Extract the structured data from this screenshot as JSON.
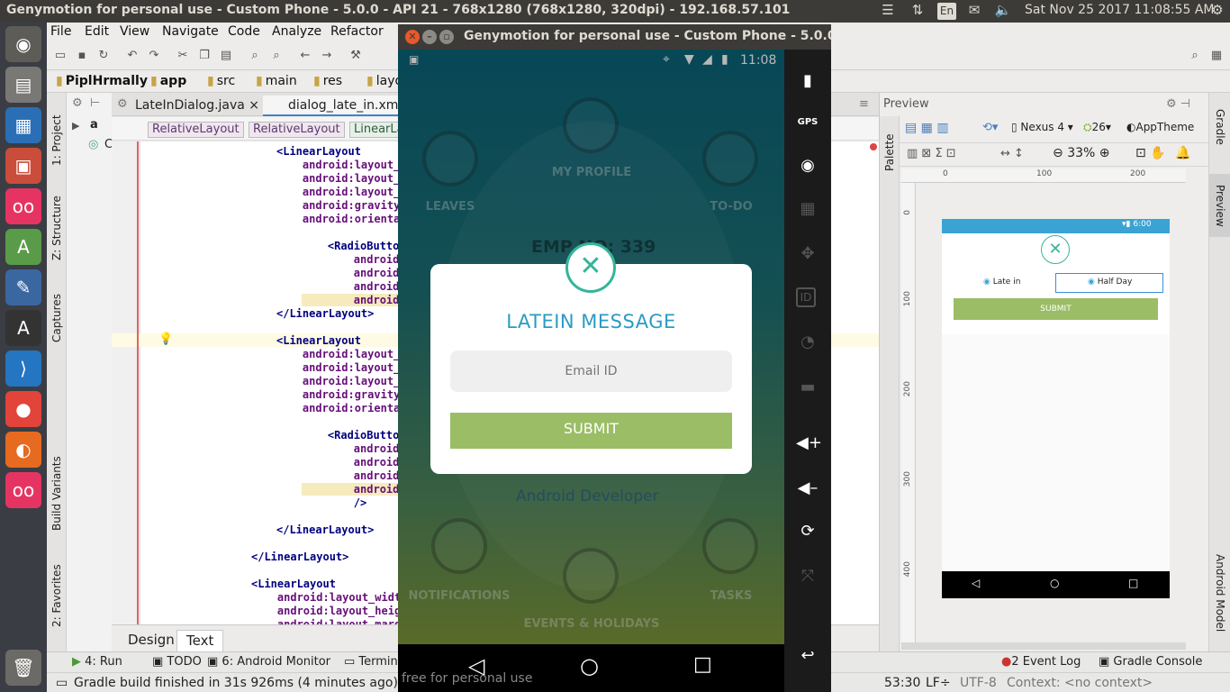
{
  "system_bar": {
    "window_title": "Genymotion for personal use - Custom Phone - 5.0.0 - API 21 - 768x1280 (768x1280, 320dpi) - 192.168.57.101",
    "keyboard_layout": "En",
    "volume": "",
    "datetime": "Sat Nov 25 2017 11:08:55 AM"
  },
  "ide": {
    "menu": [
      "File",
      "Edit",
      "View",
      "Navigate",
      "Code",
      "Analyze",
      "Refactor"
    ],
    "breadcrumbs": [
      "PiplHrmally",
      "app",
      "src",
      "main",
      "res",
      "layo"
    ],
    "editor_tabs": [
      "LateInDialog.java",
      "dialog_late_in.xml"
    ],
    "layout_crumbs": [
      "RelativeLayout",
      "RelativeLayout",
      "LinearLa"
    ],
    "project_node_a": "a",
    "project_node_c": "C",
    "left_tool_tabs": [
      "1: Project",
      "Z: Structure",
      "Captures",
      "Build Variants",
      "2: Favorites"
    ],
    "code_lines": [
      "<LinearLayout",
      "    android:layout_w",
      "    android:layout_",
      "    android:layout_w",
      "    android:gravity:",
      "    android:orientat",
      "",
      "    <RadioButton",
      "        android:layo",
      "        android:layo",
      "        android:chec",
      "        android:text",
      "</LinearLayout>",
      "",
      "<LinearLayout",
      "    android:layout_w",
      "    android:layout_",
      "    android:layout_w",
      "    android:gravity:",
      "    android:orientat",
      "",
      "    <RadioButton",
      "        android:layo",
      "        android:layo",
      "        android:chec",
      "        android:text",
      "        />",
      "",
      "</LinearLayout>",
      "",
      "</LinearLayout>",
      "",
      "<LinearLayout",
      "    android:layout_widt",
      "    android:layout_heig",
      "    android:layout_marg"
    ],
    "design_tabs": [
      "Design",
      "Text"
    ],
    "preview": {
      "label": "Preview",
      "device": "Nexus 4",
      "api": "26",
      "theme": "AppTheme",
      "zoom": "33%",
      "ruler_x": [
        "0",
        "100",
        "200"
      ],
      "ruler_y": [
        "0",
        "100",
        "200",
        "300",
        "400"
      ],
      "phone_time": "6:00",
      "radio_late": "Late in",
      "radio_half": "Half Day",
      "submit": "SUBMIT"
    },
    "right_tool_tabs": [
      "Gradle",
      "Preview",
      "Android Model"
    ],
    "palette_tab": "Palette",
    "bottom_tools": {
      "run": "4: Run",
      "todo": "TODO",
      "monitor": "6: Android Monitor",
      "terminal": "Termin",
      "event_log": "Event Log",
      "event_count": "2",
      "gradle_console": "Gradle Console"
    },
    "status": {
      "message": "Gradle build finished in 31s 926ms (4 minutes ago)",
      "position": "53:30",
      "line_sep": "LF÷",
      "encoding": "UTF-8",
      "context": "Context: <no context>"
    }
  },
  "genymotion": {
    "title": "Genymotion for personal use - Custom Phone - 5.0.0 - AP",
    "watermark": "free for personal use",
    "phone_time": "11:08",
    "side_buttons": [
      "battery",
      "GPS",
      "webcam",
      "clapper",
      "move",
      "ID",
      "rss",
      "sms",
      "vol-up",
      "vol-down",
      "rotate",
      "scale"
    ],
    "gps_label": "GPS",
    "id_label": "ID",
    "app": {
      "menu": [
        "MY PROFILE",
        "LEAVES",
        "TO-DO",
        "NOTIFICATIONS",
        "TASKS",
        "EVENTS & HOLIDAYS"
      ],
      "emp_no": "EMP NO: 339",
      "designation": "Android Developer"
    },
    "dialog": {
      "title": "LATEIN MESSAGE",
      "input_placeholder": "Email ID",
      "submit": "SUBMIT"
    }
  }
}
